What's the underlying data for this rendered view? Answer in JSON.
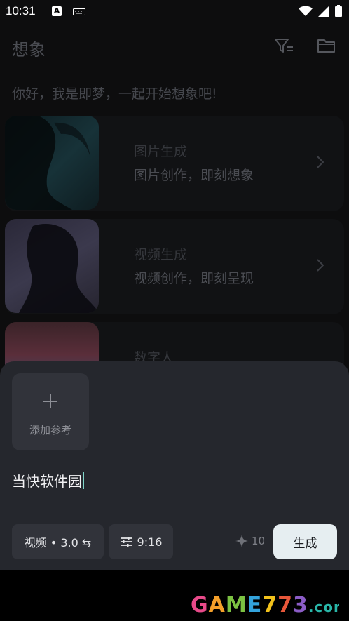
{
  "status_bar": {
    "time": "10:31",
    "keyboard_badge": "A"
  },
  "header": {
    "title": "想象",
    "filter_icon": "filter-icon",
    "folder_icon": "folder-icon"
  },
  "greeting": "你好，我是即梦，一起开始想象吧!",
  "cards": [
    {
      "title": "图片生成",
      "subtitle": "图片创作，即刻想象"
    },
    {
      "title": "视频生成",
      "subtitle": "视频创作，即刻呈现"
    },
    {
      "title": "数字人"
    }
  ],
  "panel": {
    "add_reference_label": "添加参考",
    "prompt_text": "当快软件园",
    "mode_chip": "视频 • 3.0 ⇆",
    "ratio_chip": "9:16",
    "credits": "10",
    "generate_label": "生成"
  },
  "watermark": {
    "text": "GAME773.com"
  },
  "colors": {
    "panel_bg": "#25272d",
    "generate_bg": "#e6eef1",
    "cursor": "#7fd4c8"
  }
}
